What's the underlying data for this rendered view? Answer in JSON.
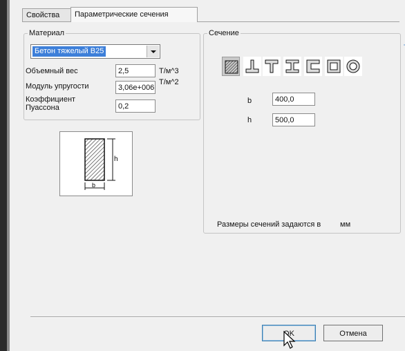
{
  "tabs": [
    {
      "label": "Свойства",
      "active": false
    },
    {
      "label": "Параметрические сечения",
      "active": true
    }
  ],
  "material": {
    "legend": "Материал",
    "selected": "Бетон тяжелый B25",
    "rows": [
      {
        "label": "Объемный вес",
        "value": "2,5",
        "unit": "Т/м^3"
      },
      {
        "label": "Модуль упругости",
        "value": "3,06e+006",
        "unit": "Т/м^2"
      },
      {
        "label": "Коэффициент\nПуассона",
        "value": "0,2",
        "unit": ""
      }
    ],
    "preview": {
      "b_label": "b",
      "h_label": "h"
    }
  },
  "section": {
    "legend": "Сечение",
    "types": [
      {
        "icon": "rectangle-section-icon",
        "active": true
      },
      {
        "icon": "inverted-tee-section-icon",
        "active": false
      },
      {
        "icon": "tee-section-icon",
        "active": false
      },
      {
        "icon": "i-beam-section-icon",
        "active": false
      },
      {
        "icon": "channel-section-icon",
        "active": false
      },
      {
        "icon": "box-section-icon",
        "active": false
      },
      {
        "icon": "ring-section-icon",
        "active": false
      }
    ],
    "b_label": "b",
    "b_value": "400,0",
    "h_label": "h",
    "h_value": "500,0",
    "units_note": "Размеры сечений задаются в",
    "units_value": "мм"
  },
  "buttons": {
    "ok": "OK",
    "cancel": "Отмена"
  }
}
